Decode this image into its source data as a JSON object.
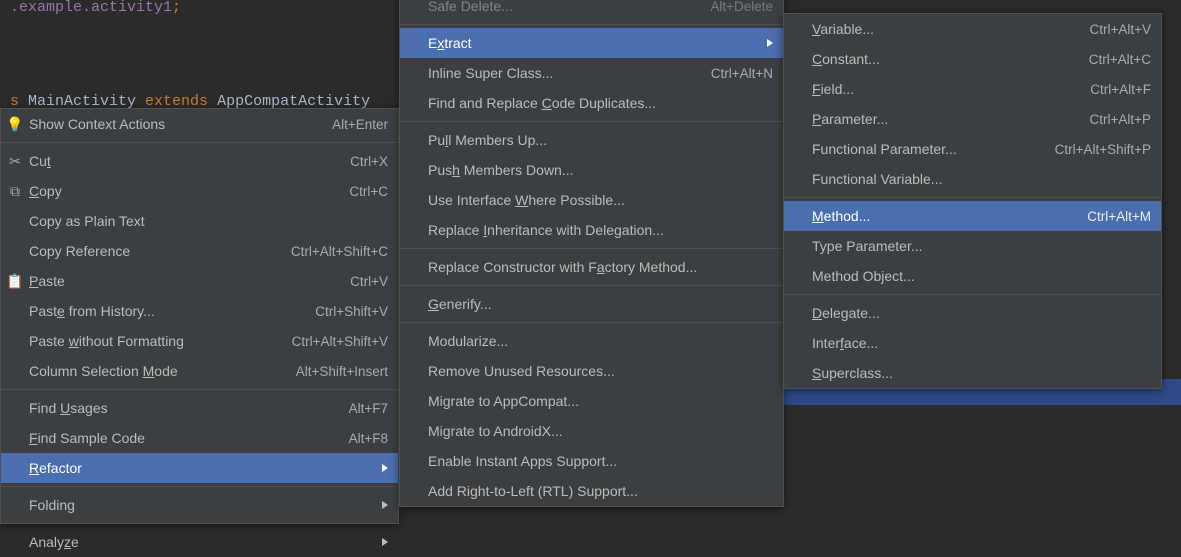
{
  "code": {
    "line1a": ".example.activity1",
    "line1b": ";",
    "line2a": "s ",
    "line2b": "MainActivity ",
    "line2c": "extends ",
    "line2d": "AppCompatActivity"
  },
  "menu1": {
    "show_context_actions": {
      "label": "Show Context Actions",
      "shortcut": "Alt+Enter"
    },
    "cut": {
      "label_pre": "Cu",
      "mnemonic": "t",
      "label_post": "",
      "shortcut": "Ctrl+X"
    },
    "copy": {
      "mnemonic": "C",
      "label_post": "opy",
      "shortcut": "Ctrl+C"
    },
    "copy_plain": {
      "label": "Copy as Plain Text"
    },
    "copy_reference": {
      "label": "Copy Reference",
      "shortcut": "Ctrl+Alt+Shift+C"
    },
    "paste": {
      "mnemonic": "P",
      "label_post": "aste",
      "shortcut": "Ctrl+V"
    },
    "paste_history": {
      "label_pre": "Past",
      "mnemonic": "e",
      "label_post": " from History...",
      "shortcut": "Ctrl+Shift+V"
    },
    "paste_without_fmt": {
      "label_pre": "Paste ",
      "mnemonic": "w",
      "label_post": "ithout Formatting",
      "shortcut": "Ctrl+Alt+Shift+V"
    },
    "col_sel_mode": {
      "label_pre": "Column Selection ",
      "mnemonic": "M",
      "label_post": "ode",
      "shortcut": "Alt+Shift+Insert"
    },
    "find_usages": {
      "label_pre": "Find ",
      "mnemonic": "U",
      "label_post": "sages",
      "shortcut": "Alt+F7"
    },
    "find_sample": {
      "mnemonic": "F",
      "label_post": "ind Sample Code",
      "shortcut": "Alt+F8"
    },
    "refactor": {
      "mnemonic": "R",
      "label_post": "efactor"
    },
    "folding": {
      "label_pre": "Foldin",
      "mnemonic": "g",
      "label_post": ""
    },
    "analyze": {
      "label_pre": "Analy",
      "mnemonic": "z",
      "label_post": "e"
    }
  },
  "menu2": {
    "safe_delete": {
      "label": "Safe Delete...",
      "shortcut": "Alt+Delete"
    },
    "extract": {
      "label_pre": "E",
      "mnemonic": "x",
      "label_post": "tract"
    },
    "inline_super": {
      "label": "Inline Super Class...",
      "shortcut": "Ctrl+Alt+N"
    },
    "find_dupes": {
      "label_pre": "Find and Replace ",
      "mnemonic": "C",
      "label_post": "ode Duplicates..."
    },
    "pull_up": {
      "label_pre": "Pu",
      "mnemonic": "l",
      "label_post": "l Members Up..."
    },
    "push_down": {
      "label_pre": "Pus",
      "mnemonic": "h",
      "label_post": " Members Down..."
    },
    "use_interface": {
      "label_pre": "Use Interface ",
      "mnemonic": "W",
      "label_post": "here Possible..."
    },
    "replace_inh": {
      "label_pre": "Replace ",
      "mnemonic": "I",
      "label_post": "nheritance with Delegation..."
    },
    "replace_ctor": {
      "label_pre": "Replace Constructor with F",
      "mnemonic": "a",
      "label_post": "ctory Method..."
    },
    "generify": {
      "mnemonic": "G",
      "label_post": "enerify..."
    },
    "modularize": {
      "label": "Modularize..."
    },
    "remove_unused": {
      "label": "Remove Unused Resources..."
    },
    "migrate_appcompat": {
      "label": "Migrate to AppCompat..."
    },
    "migrate_androidx": {
      "label": "Migrate to AndroidX..."
    },
    "enable_instant": {
      "label": "Enable Instant Apps Support..."
    },
    "add_rtl": {
      "label": "Add Right-to-Left (RTL) Support..."
    }
  },
  "menu3": {
    "variable": {
      "mnemonic": "V",
      "label_post": "ariable...",
      "shortcut": "Ctrl+Alt+V"
    },
    "constant": {
      "mnemonic": "C",
      "label_post": "onstant...",
      "shortcut": "Ctrl+Alt+C"
    },
    "field": {
      "mnemonic": "F",
      "label_post": "ield...",
      "shortcut": "Ctrl+Alt+F"
    },
    "parameter": {
      "mnemonic": "P",
      "label_post": "arameter...",
      "shortcut": "Ctrl+Alt+P"
    },
    "func_param": {
      "label": "Functional Parameter...",
      "shortcut": "Ctrl+Alt+Shift+P"
    },
    "func_var": {
      "label": "Functional Variable..."
    },
    "method": {
      "mnemonic": "M",
      "label_post": "ethod...",
      "shortcut": "Ctrl+Alt+M"
    },
    "type_param": {
      "label": "Type Parameter..."
    },
    "method_object": {
      "label": "Method Object..."
    },
    "delegate": {
      "mnemonic": "D",
      "label_post": "elegate..."
    },
    "interface": {
      "label_pre": "Inter",
      "mnemonic": "f",
      "label_post": "ace..."
    },
    "superclass": {
      "mnemonic": "S",
      "label_post": "uperclass..."
    }
  }
}
